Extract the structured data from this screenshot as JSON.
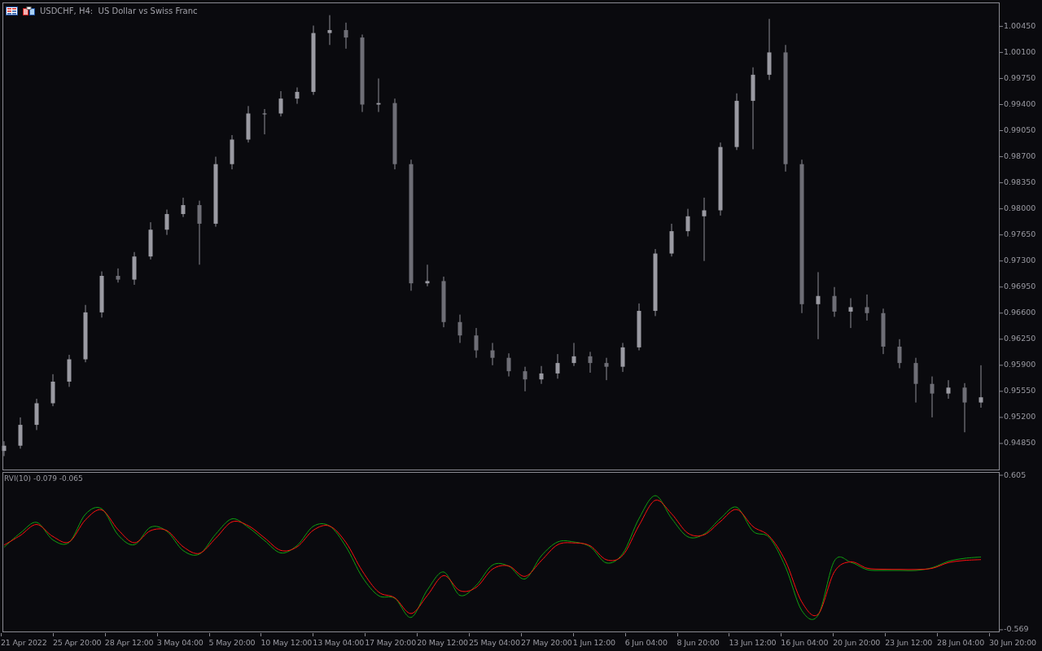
{
  "chart": {
    "title": "USDCHF, H4:  US Dollar vs Swiss Franc",
    "chart_data": {
      "type": "candlestick",
      "ylim": [
        0.945,
        1.0076
      ],
      "yticks": [
        {
          "value": 1.0045,
          "label": "1.00450"
        },
        {
          "value": 1.001,
          "label": "1.00100"
        },
        {
          "value": 0.9975,
          "label": "0.99750"
        },
        {
          "value": 0.994,
          "label": "0.99400"
        },
        {
          "value": 0.9905,
          "label": "0.99050"
        },
        {
          "value": 0.987,
          "label": "0.98700"
        },
        {
          "value": 0.9835,
          "label": "0.98350"
        },
        {
          "value": 0.98,
          "label": "0.98000"
        },
        {
          "value": 0.9765,
          "label": "0.97650"
        },
        {
          "value": 0.973,
          "label": "0.97300"
        },
        {
          "value": 0.9695,
          "label": "0.96950"
        },
        {
          "value": 0.966,
          "label": "0.96600"
        },
        {
          "value": 0.9625,
          "label": "0.96250"
        },
        {
          "value": 0.959,
          "label": "0.95900"
        },
        {
          "value": 0.9555,
          "label": "0.95550"
        },
        {
          "value": 0.952,
          "label": "0.95200"
        },
        {
          "value": 0.9485,
          "label": "0.94850"
        }
      ],
      "ohlc": [
        [
          0.9475,
          0.9488,
          0.9468,
          0.9482
        ],
        [
          0.9482,
          0.952,
          0.9478,
          0.951
        ],
        [
          0.951,
          0.9545,
          0.9503,
          0.9539
        ],
        [
          0.9539,
          0.9578,
          0.9535,
          0.9568
        ],
        [
          0.9568,
          0.9604,
          0.9561,
          0.9598
        ],
        [
          0.9598,
          0.9671,
          0.9594,
          0.9661
        ],
        [
          0.9661,
          0.9716,
          0.9654,
          0.971
        ],
        [
          0.971,
          0.972,
          0.9701,
          0.9705
        ],
        [
          0.9705,
          0.9742,
          0.9698,
          0.9736
        ],
        [
          0.9736,
          0.9782,
          0.9732,
          0.9772
        ],
        [
          0.9772,
          0.9799,
          0.9765,
          0.9793
        ],
        [
          0.9793,
          0.9815,
          0.9789,
          0.9805
        ],
        [
          0.9805,
          0.9811,
          0.9725,
          0.978
        ],
        [
          0.978,
          0.987,
          0.9776,
          0.986
        ],
        [
          0.986,
          0.9899,
          0.9853,
          0.9893
        ],
        [
          0.9893,
          0.9938,
          0.9889,
          0.9928
        ],
        [
          0.9928,
          0.9934,
          0.99,
          0.9928
        ],
        [
          0.9928,
          0.9958,
          0.9924,
          0.9948
        ],
        [
          0.9948,
          0.9963,
          0.9941,
          0.9957
        ],
        [
          0.9957,
          1.0046,
          0.9953,
          1.0036
        ],
        [
          1.0036,
          1.006,
          1.002,
          1.004
        ],
        [
          1.004,
          1.005,
          1.0015,
          1.003
        ],
        [
          1.003,
          1.0034,
          0.993,
          0.994
        ],
        [
          0.994,
          0.9975,
          0.993,
          0.9942
        ],
        [
          0.9942,
          0.9948,
          0.9853,
          0.986
        ],
        [
          0.986,
          0.9866,
          0.969,
          0.97
        ],
        [
          0.97,
          0.9725,
          0.9696,
          0.9703
        ],
        [
          0.9703,
          0.9709,
          0.9641,
          0.9648
        ],
        [
          0.9648,
          0.9658,
          0.962,
          0.963
        ],
        [
          0.963,
          0.964,
          0.96,
          0.961
        ],
        [
          0.961,
          0.962,
          0.959,
          0.96
        ],
        [
          0.96,
          0.9606,
          0.9575,
          0.9582
        ],
        [
          0.9582,
          0.9588,
          0.9555,
          0.9571
        ],
        [
          0.9571,
          0.9589,
          0.9565,
          0.9579
        ],
        [
          0.9579,
          0.9605,
          0.9572,
          0.9593
        ],
        [
          0.9593,
          0.962,
          0.9589,
          0.9602
        ],
        [
          0.9602,
          0.9608,
          0.958,
          0.9593
        ],
        [
          0.9593,
          0.96,
          0.957,
          0.9588
        ],
        [
          0.9588,
          0.962,
          0.9581,
          0.9614
        ],
        [
          0.9614,
          0.9673,
          0.961,
          0.9663
        ],
        [
          0.9663,
          0.9746,
          0.9656,
          0.974
        ],
        [
          0.974,
          0.978,
          0.9736,
          0.977
        ],
        [
          0.977,
          0.98,
          0.9763,
          0.979
        ],
        [
          0.979,
          0.9815,
          0.973,
          0.9798
        ],
        [
          0.9798,
          0.9889,
          0.9791,
          0.9883
        ],
        [
          0.9883,
          0.9955,
          0.9879,
          0.9945
        ],
        [
          0.9945,
          0.999,
          0.988,
          0.998
        ],
        [
          0.998,
          1.0055,
          0.9973,
          1.001
        ],
        [
          1.001,
          1.002,
          0.985,
          0.986
        ],
        [
          0.986,
          0.9866,
          0.966,
          0.9672
        ],
        [
          0.9672,
          0.9715,
          0.9625,
          0.9683
        ],
        [
          0.9683,
          0.9695,
          0.9655,
          0.9662
        ],
        [
          0.9662,
          0.968,
          0.964,
          0.9668
        ],
        [
          0.9668,
          0.9685,
          0.965,
          0.966
        ],
        [
          0.966,
          0.9666,
          0.9605,
          0.9615
        ],
        [
          0.9615,
          0.9625,
          0.9586,
          0.9593
        ],
        [
          0.9593,
          0.96,
          0.954,
          0.9565
        ],
        [
          0.9565,
          0.9575,
          0.952,
          0.9552
        ],
        [
          0.9552,
          0.957,
          0.9545,
          0.956
        ],
        [
          0.956,
          0.9566,
          0.95,
          0.954
        ],
        [
          0.954,
          0.959,
          0.9533,
          0.9547
        ]
      ]
    }
  },
  "indicator": {
    "label": "RVI(10) -0.079 -0.065",
    "chart_data": {
      "type": "line",
      "ylim": [
        -0.588,
        0.63
      ],
      "yticks": [
        {
          "value": 0.605,
          "label": "0.605"
        },
        {
          "value": -0.569,
          "label": "-0.569"
        }
      ],
      "series": [
        {
          "color": "#10a010",
          "values": [
            0.058,
            0.166,
            0.247,
            0.114,
            0.095,
            0.31,
            0.35,
            0.152,
            0.077,
            0.211,
            0.179,
            0.033,
            0.006,
            0.158,
            0.274,
            0.209,
            0.109,
            0.015,
            0.072,
            0.218,
            0.219,
            0.062,
            -0.168,
            -0.31,
            -0.33,
            -0.475,
            -0.266,
            -0.13,
            -0.308,
            -0.231,
            -0.077,
            -0.086,
            -0.183,
            -0.007,
            0.098,
            0.098,
            0.061,
            -0.061,
            0.01,
            0.277,
            0.45,
            0.277,
            0.137,
            0.158,
            0.277,
            0.362,
            0.179,
            0.132,
            -0.093,
            -0.424,
            -0.458,
            -0.045,
            -0.055,
            -0.112,
            -0.118,
            -0.118,
            -0.118,
            -0.098,
            -0.049,
            -0.026,
            -0.016
          ]
        },
        {
          "color": "#ff1010",
          "values": [
            0.074,
            0.148,
            0.231,
            0.14,
            0.099,
            0.267,
            0.342,
            0.192,
            0.092,
            0.184,
            0.185,
            0.062,
            0.012,
            0.127,
            0.251,
            0.222,
            0.129,
            0.034,
            0.061,
            0.188,
            0.219,
            0.094,
            -0.122,
            -0.282,
            -0.326,
            -0.446,
            -0.308,
            -0.157,
            -0.272,
            -0.247,
            -0.108,
            -0.084,
            -0.163,
            -0.043,
            0.077,
            0.091,
            0.069,
            -0.037,
            -0.004,
            0.224,
            0.415,
            0.312,
            0.165,
            0.153,
            0.254,
            0.345,
            0.215,
            0.142,
            -0.048,
            -0.358,
            -0.451,
            -0.128,
            -0.053,
            -0.101,
            -0.109,
            -0.11,
            -0.111,
            -0.102,
            -0.059,
            -0.042,
            -0.036
          ]
        }
      ]
    }
  },
  "time_axis": [
    "21 Apr 2022",
    "25 Apr 20:00",
    "28 Apr 12:00",
    "3 May 04:00",
    "5 May 20:00",
    "10 May 12:00",
    "13 May 04:00",
    "17 May 20:00",
    "20 May 12:00",
    "25 May 04:00",
    "27 May 20:00",
    "1 Jun 12:00",
    "6 Jun 04:00",
    "8 Jun 20:00",
    "13 Jun 12:00",
    "16 Jun 04:00",
    "20 Jun 20:00",
    "23 Jun 12:00",
    "28 Jun 04:00",
    "30 Jun 20:00"
  ]
}
